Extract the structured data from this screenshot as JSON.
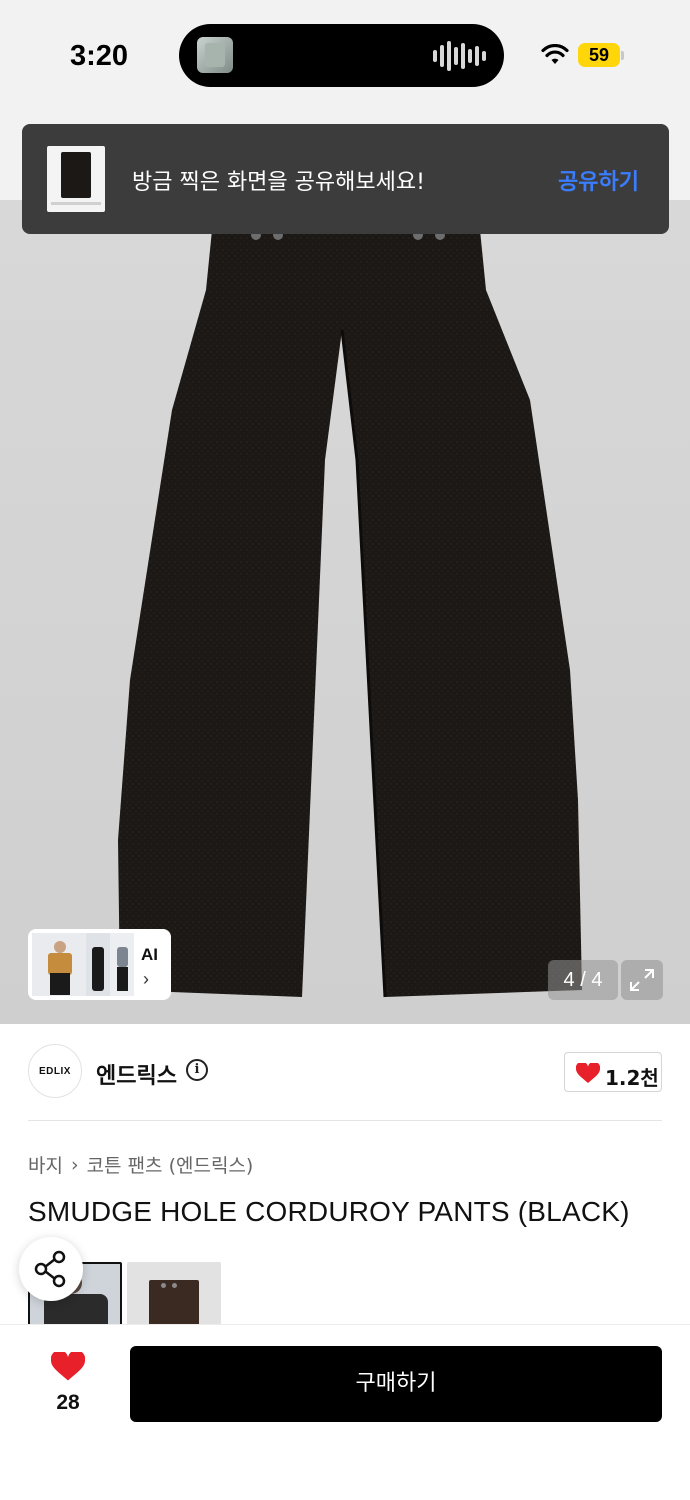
{
  "status_bar": {
    "time": "3:20",
    "battery": "59",
    "icons": [
      "wifi-icon",
      "battery-icon"
    ]
  },
  "toast": {
    "message": "방금 찍은 화면을 공유해보세요!",
    "action_label": "공유하기",
    "action_color": "#3a7dff"
  },
  "gallery": {
    "ai_label": "AI",
    "ai_chevron": "›",
    "counter": "4 / 4",
    "expand_icon": "expand-icon"
  },
  "brand": {
    "logo_text": "EDLIX",
    "name": "엔드릭스",
    "info_icon": "i",
    "like_count": "1.2천"
  },
  "product": {
    "breadcrumb": [
      "바지",
      "›",
      "코튼 팬츠 (엔드릭스)"
    ],
    "title": "SMUDGE HOLE CORDUROY PANTS (BLACK)"
  },
  "bottom_bar": {
    "wish_count": "28",
    "buy_label": "구매하기",
    "heart_color": "#e8202a"
  }
}
